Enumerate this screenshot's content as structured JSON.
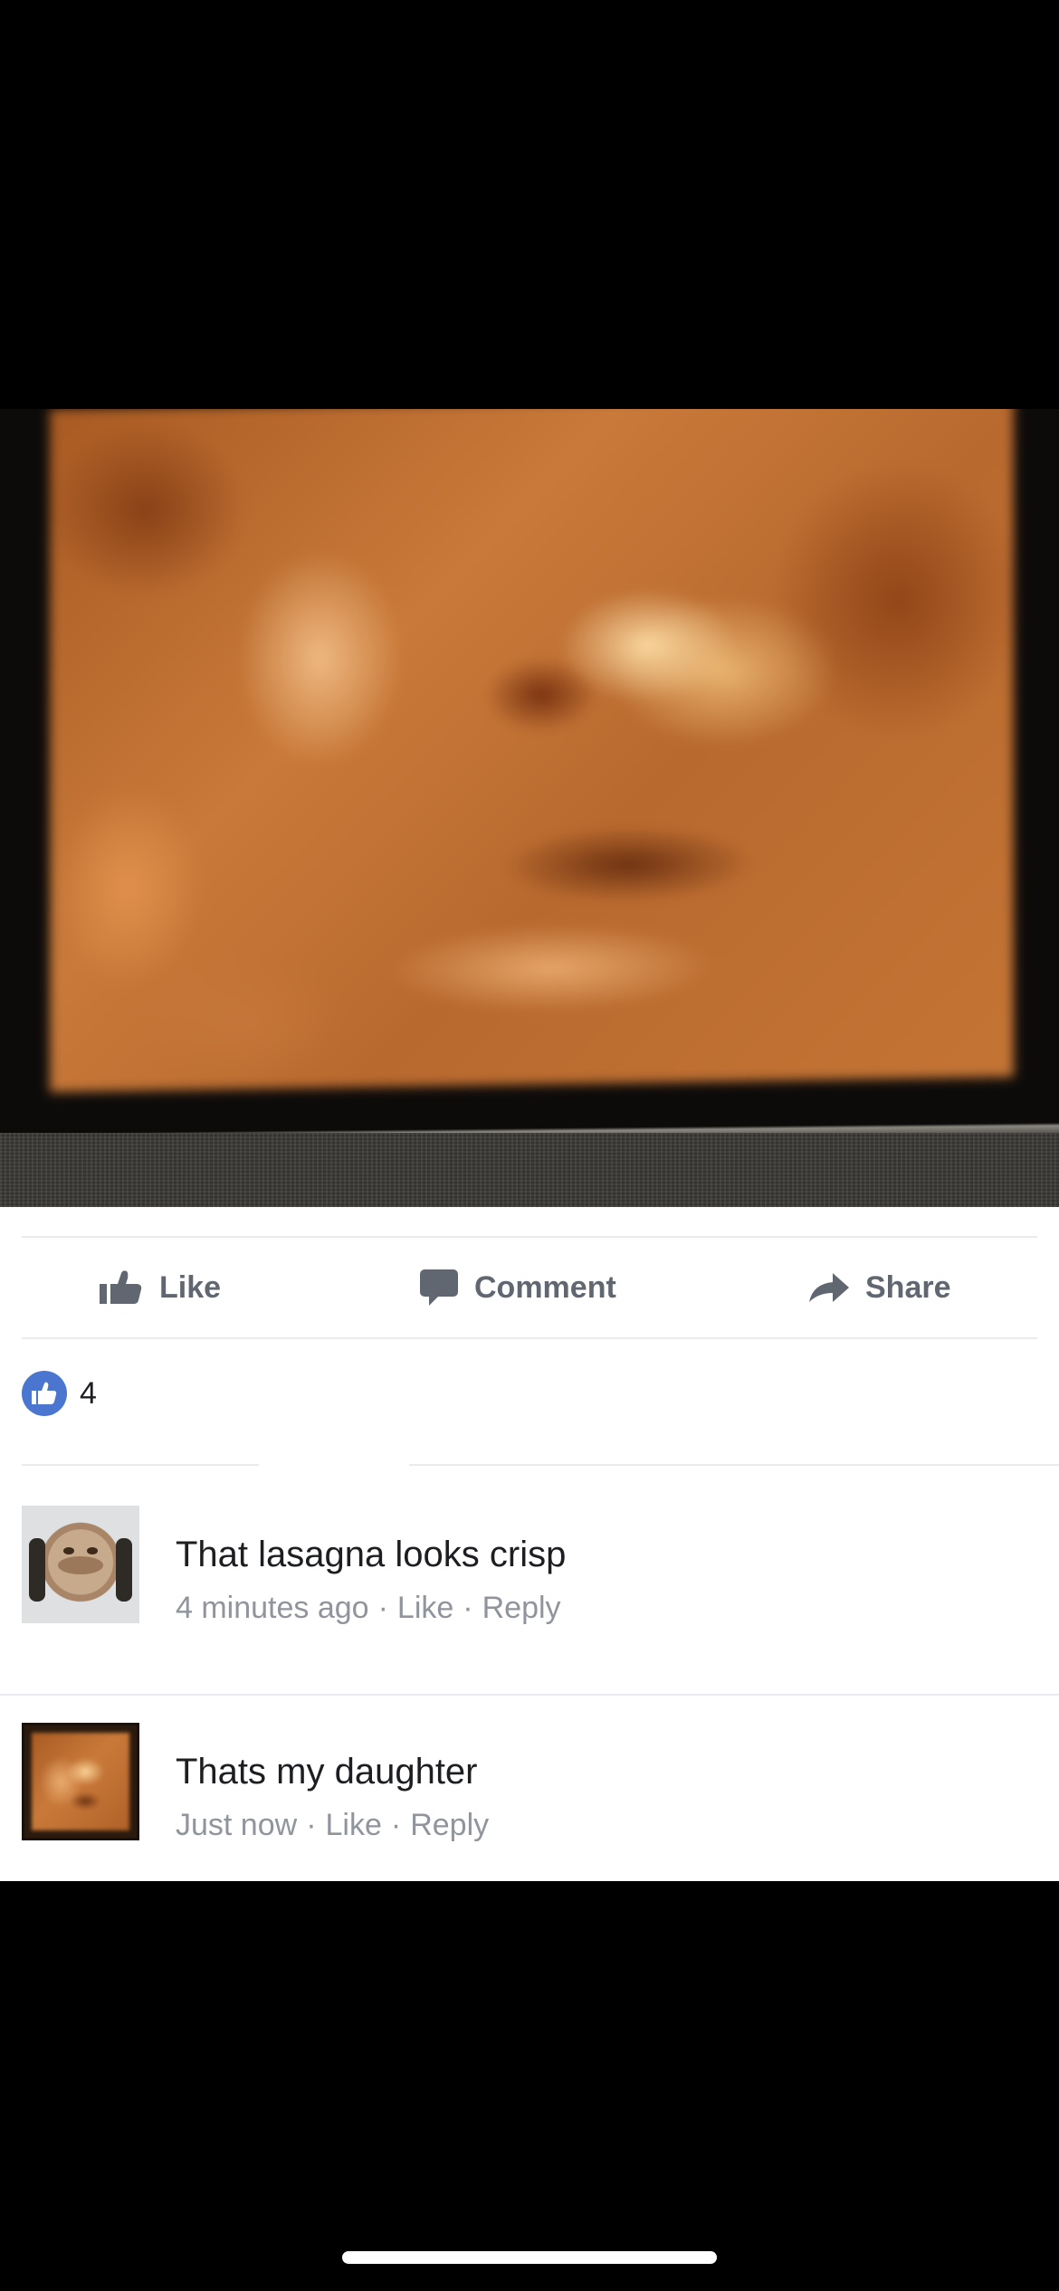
{
  "post": {
    "photo_description_icon": "ultrasound-photo"
  },
  "actions": {
    "like_label": "Like",
    "comment_label": "Comment",
    "share_label": "Share"
  },
  "reactions": {
    "count": "4"
  },
  "comments": [
    {
      "text": "That lasagna looks crisp",
      "time": "4 minutes ago",
      "like_label": "Like",
      "reply_label": "Reply"
    },
    {
      "text": "Thats my daughter",
      "time": "Just now",
      "like_label": "Like",
      "reply_label": "Reply"
    }
  ],
  "colors": {
    "reaction_blue": "#4a76d0",
    "action_gray": "#606770",
    "meta_gray": "#90949c",
    "text_dark": "#1c1e21"
  }
}
